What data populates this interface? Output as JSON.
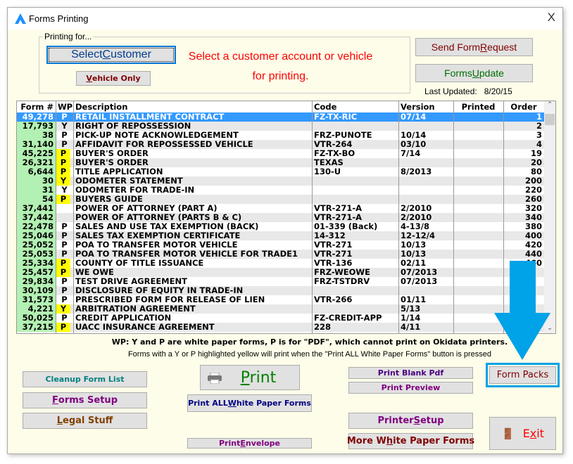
{
  "window": {
    "title": "Forms Printing",
    "close": "X"
  },
  "printing_for": {
    "label": "Printing for...",
    "select_customer": "Select Customer",
    "vehicle_only": "Vehicle Only",
    "message_line1": "Select a customer account or vehicle",
    "message_line2": "for printing."
  },
  "right_top": {
    "send_form_request": "Send Form Request",
    "forms_update": "Forms Update",
    "last_updated_label": "Last Updated:",
    "last_updated_value": "8/20/15"
  },
  "table": {
    "columns": [
      "Form #",
      "WP",
      "Description",
      "Code",
      "Version",
      "Printed",
      "Order"
    ],
    "selected_index": 0,
    "rows": [
      [
        "49,278",
        "P",
        "RETAIL INSTALLMENT CONTRACT",
        "FZ-TX-RIC",
        "07/14",
        "",
        "1",
        false
      ],
      [
        "17,793",
        "Y",
        "RIGHT OF REPOSSESSION",
        "",
        "",
        "",
        "2",
        false
      ],
      [
        "38",
        "P",
        "PICK-UP NOTE ACKNOWLEDGEMENT",
        "FRZ-PUNOTE",
        "10/14",
        "",
        "3",
        false
      ],
      [
        "31,140",
        "P",
        "AFFIDAVIT FOR REPOSSESSED VEHICLE",
        "VTR-264",
        "03/10",
        "",
        "4",
        false
      ],
      [
        "45,225",
        "P",
        "BUYER'S ORDER",
        "FZ-TX-BO",
        "7/14",
        "",
        "19",
        true
      ],
      [
        "26,321",
        "P",
        "BUYER'S ORDER",
        "TEXAS",
        "",
        "",
        "20",
        true
      ],
      [
        "6,644",
        "P",
        "TITLE APPLICATION",
        "130-U",
        "8/2013",
        "",
        "80",
        true
      ],
      [
        "30",
        "Y",
        "ODOMETER STATEMENT",
        "",
        "",
        "",
        "200",
        true
      ],
      [
        "31",
        "Y",
        "ODOMETER FOR TRADE-IN",
        "",
        "",
        "",
        "220",
        false
      ],
      [
        "54",
        "P",
        "BUYERS GUIDE",
        "",
        "",
        "",
        "260",
        true
      ],
      [
        "37,441",
        "",
        "POWER OF ATTORNEY (PART A)",
        "VTR-271-A",
        "2/2010",
        "",
        "320",
        false
      ],
      [
        "37,442",
        "",
        "POWER OF ATTORNEY (PARTS B & C)",
        "VTR-271-A",
        "2/2010",
        "",
        "340",
        false
      ],
      [
        "22,478",
        "P",
        "SALES AND USE TAX EXEMPTION (BACK)",
        "01-339 (Back)",
        "4-13/8",
        "",
        "380",
        false
      ],
      [
        "25,046",
        "P",
        "SALES TAX EXEMPTION CERTIFICATE",
        "14-312",
        "12-12/4",
        "",
        "400",
        false
      ],
      [
        "25,052",
        "P",
        "POA TO TRANSFER MOTOR VEHICLE",
        "VTR-271",
        "10/13",
        "",
        "420",
        false
      ],
      [
        "25,053",
        "P",
        "POA TO TRANSFER MOTOR VEHICLE FOR TRADE1",
        "VTR-271",
        "10/13",
        "",
        "440",
        false
      ],
      [
        "25,334",
        "P",
        "COUNTY OF TITLE ISSUANCE",
        "VTR-136",
        "02/11",
        "",
        "460",
        true
      ],
      [
        "25,457",
        "P",
        "WE OWE",
        "FRZ-WEOWE",
        "07/2013",
        "",
        "",
        true
      ],
      [
        "29,834",
        "P",
        "TEST DRIVE AGREEMENT",
        "FRZ-TSTDRV",
        "07/2013",
        "",
        "",
        false
      ],
      [
        "30,109",
        "P",
        "DISCLOSURE OF EQUITY IN TRADE-IN",
        "",
        "",
        "",
        "",
        false
      ],
      [
        "31,573",
        "P",
        "PRESCRIBED FORM FOR RELEASE OF LIEN",
        "VTR-266",
        "01/11",
        "",
        "",
        false
      ],
      [
        "4,221",
        "Y",
        "ARBITRATION AGREEMENT",
        "",
        "5/13",
        "",
        "",
        true
      ],
      [
        "50,025",
        "P",
        "CREDIT APPLICATION",
        "FZ-CREDIT-APP",
        "1/14",
        "",
        "",
        false
      ],
      [
        "37,215",
        "P",
        "UACC INSURANCE AGREEMENT",
        "228",
        "4/11",
        "",
        "",
        true
      ]
    ]
  },
  "notes": {
    "line1": "WP: Y and P are white paper forms, P is for \"PDF\", which cannot print on Okidata printers.",
    "line2": "Forms with a Y or P highlighted yellow will print when the \"Print ALL White Paper Forms\" button is pressed"
  },
  "buttons": {
    "cleanup": "Cleanup Form List",
    "forms_setup": "Forms Setup",
    "legal": "Legal Stuff",
    "print": "Print",
    "print_all_white": "Print ALL White Paper Forms",
    "print_envelope": "Print Envelope",
    "print_blank_pdf": "Print Blank Pdf",
    "print_preview": "Print Preview",
    "printer_setup": "Printer Setup",
    "more_white": "More White Paper Forms",
    "form_packs": "Form Packs",
    "exit": "Exit"
  },
  "colors": {
    "selection": "#3399ff",
    "form_green": "#b3f0b3",
    "wp_yellow": "#ffff00",
    "annotation_arrow": "#00a2e8",
    "message_red": "#ff0000"
  }
}
